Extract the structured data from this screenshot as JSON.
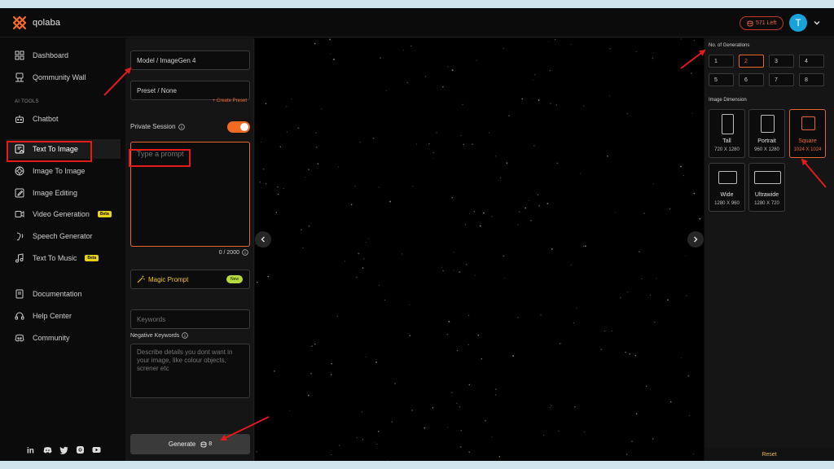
{
  "app": {
    "logo_text": "qolaba",
    "credits": "571 Left",
    "user_initial": "T"
  },
  "sidebar": {
    "top_items": [
      {
        "label": "Dashboard",
        "icon": "grid-icon"
      },
      {
        "label": "Qommunity Wall",
        "icon": "community-wall-icon"
      }
    ],
    "section_label": "AI TOOLS",
    "tools": [
      {
        "label": "Chatbot",
        "icon": "chatbot-icon"
      },
      {
        "label": "Text To Image",
        "icon": "text-to-image-icon",
        "active": true
      },
      {
        "label": "Image To Image",
        "icon": "image-to-image-icon"
      },
      {
        "label": "Image Editing",
        "icon": "image-editing-icon"
      },
      {
        "label": "Video Generation",
        "icon": "video-icon",
        "badge": "Beta"
      },
      {
        "label": "Speech Generator",
        "icon": "speech-icon"
      },
      {
        "label": "Text To Music",
        "icon": "music-icon",
        "badge": "Beta"
      }
    ],
    "bottom_items": [
      {
        "label": "Documentation",
        "icon": "book-icon"
      },
      {
        "label": "Help Center",
        "icon": "headset-icon"
      },
      {
        "label": "Community",
        "icon": "discord-icon"
      }
    ],
    "socials": [
      "linkedin-icon",
      "discord-icon",
      "twitter-icon",
      "instagram-icon",
      "youtube-icon"
    ]
  },
  "form": {
    "model": "Model / ImageGen 4",
    "preset": "Preset / None",
    "create_preset": "+ Create Preset",
    "private_session_label": "Private Session",
    "private_session_on": true,
    "prompt_placeholder": "Type a prompt",
    "prompt_counter": "0 / 2000",
    "magic_prompt_label": "Magic Prompt",
    "magic_prompt_badge": "New",
    "keywords_placeholder": "Keywords",
    "negative_keywords_label": "Negative Keywords",
    "negative_keywords_placeholder": "Describe details you dont want in your image, like colour objects, screner etc",
    "generate_label": "Generate",
    "generate_cost": "8"
  },
  "settings": {
    "generations_label": "No. of Generations",
    "generation_options": [
      "1",
      "2",
      "3",
      "4",
      "5",
      "6",
      "7",
      "8"
    ],
    "selected_generation": "2",
    "dimension_label": "Image Dimension",
    "dimensions": [
      {
        "name": "Tall",
        "size": "720 X 1280"
      },
      {
        "name": "Portrait",
        "size": "960 X 1280"
      },
      {
        "name": "Square",
        "size": "1024 X 1024",
        "selected": true
      },
      {
        "name": "Wide",
        "size": "1280 X 960"
      },
      {
        "name": "Ultrawide",
        "size": "1280 X 720"
      }
    ],
    "reset_label": "Reset"
  },
  "colors": {
    "accent": "#e8662c",
    "annotation": "#e31b1b",
    "avatar": "#17a3d9"
  }
}
